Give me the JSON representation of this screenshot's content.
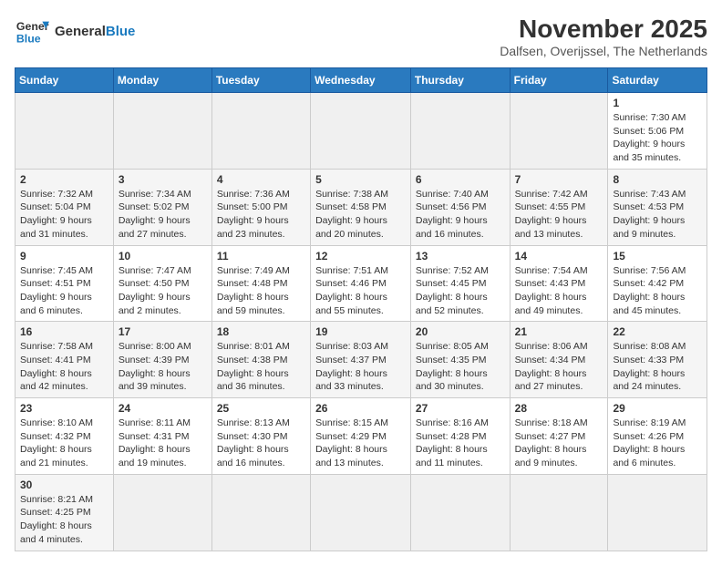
{
  "header": {
    "logo_general": "General",
    "logo_blue": "Blue",
    "month_title": "November 2025",
    "subtitle": "Dalfsen, Overijssel, The Netherlands"
  },
  "days_of_week": [
    "Sunday",
    "Monday",
    "Tuesday",
    "Wednesday",
    "Thursday",
    "Friday",
    "Saturday"
  ],
  "weeks": [
    [
      {
        "day": "",
        "info": ""
      },
      {
        "day": "",
        "info": ""
      },
      {
        "day": "",
        "info": ""
      },
      {
        "day": "",
        "info": ""
      },
      {
        "day": "",
        "info": ""
      },
      {
        "day": "",
        "info": ""
      },
      {
        "day": "1",
        "info": "Sunrise: 7:30 AM\nSunset: 5:06 PM\nDaylight: 9 hours and 35 minutes."
      }
    ],
    [
      {
        "day": "2",
        "info": "Sunrise: 7:32 AM\nSunset: 5:04 PM\nDaylight: 9 hours and 31 minutes."
      },
      {
        "day": "3",
        "info": "Sunrise: 7:34 AM\nSunset: 5:02 PM\nDaylight: 9 hours and 27 minutes."
      },
      {
        "day": "4",
        "info": "Sunrise: 7:36 AM\nSunset: 5:00 PM\nDaylight: 9 hours and 23 minutes."
      },
      {
        "day": "5",
        "info": "Sunrise: 7:38 AM\nSunset: 4:58 PM\nDaylight: 9 hours and 20 minutes."
      },
      {
        "day": "6",
        "info": "Sunrise: 7:40 AM\nSunset: 4:56 PM\nDaylight: 9 hours and 16 minutes."
      },
      {
        "day": "7",
        "info": "Sunrise: 7:42 AM\nSunset: 4:55 PM\nDaylight: 9 hours and 13 minutes."
      },
      {
        "day": "8",
        "info": "Sunrise: 7:43 AM\nSunset: 4:53 PM\nDaylight: 9 hours and 9 minutes."
      }
    ],
    [
      {
        "day": "9",
        "info": "Sunrise: 7:45 AM\nSunset: 4:51 PM\nDaylight: 9 hours and 6 minutes."
      },
      {
        "day": "10",
        "info": "Sunrise: 7:47 AM\nSunset: 4:50 PM\nDaylight: 9 hours and 2 minutes."
      },
      {
        "day": "11",
        "info": "Sunrise: 7:49 AM\nSunset: 4:48 PM\nDaylight: 8 hours and 59 minutes."
      },
      {
        "day": "12",
        "info": "Sunrise: 7:51 AM\nSunset: 4:46 PM\nDaylight: 8 hours and 55 minutes."
      },
      {
        "day": "13",
        "info": "Sunrise: 7:52 AM\nSunset: 4:45 PM\nDaylight: 8 hours and 52 minutes."
      },
      {
        "day": "14",
        "info": "Sunrise: 7:54 AM\nSunset: 4:43 PM\nDaylight: 8 hours and 49 minutes."
      },
      {
        "day": "15",
        "info": "Sunrise: 7:56 AM\nSunset: 4:42 PM\nDaylight: 8 hours and 45 minutes."
      }
    ],
    [
      {
        "day": "16",
        "info": "Sunrise: 7:58 AM\nSunset: 4:41 PM\nDaylight: 8 hours and 42 minutes."
      },
      {
        "day": "17",
        "info": "Sunrise: 8:00 AM\nSunset: 4:39 PM\nDaylight: 8 hours and 39 minutes."
      },
      {
        "day": "18",
        "info": "Sunrise: 8:01 AM\nSunset: 4:38 PM\nDaylight: 8 hours and 36 minutes."
      },
      {
        "day": "19",
        "info": "Sunrise: 8:03 AM\nSunset: 4:37 PM\nDaylight: 8 hours and 33 minutes."
      },
      {
        "day": "20",
        "info": "Sunrise: 8:05 AM\nSunset: 4:35 PM\nDaylight: 8 hours and 30 minutes."
      },
      {
        "day": "21",
        "info": "Sunrise: 8:06 AM\nSunset: 4:34 PM\nDaylight: 8 hours and 27 minutes."
      },
      {
        "day": "22",
        "info": "Sunrise: 8:08 AM\nSunset: 4:33 PM\nDaylight: 8 hours and 24 minutes."
      }
    ],
    [
      {
        "day": "23",
        "info": "Sunrise: 8:10 AM\nSunset: 4:32 PM\nDaylight: 8 hours and 21 minutes."
      },
      {
        "day": "24",
        "info": "Sunrise: 8:11 AM\nSunset: 4:31 PM\nDaylight: 8 hours and 19 minutes."
      },
      {
        "day": "25",
        "info": "Sunrise: 8:13 AM\nSunset: 4:30 PM\nDaylight: 8 hours and 16 minutes."
      },
      {
        "day": "26",
        "info": "Sunrise: 8:15 AM\nSunset: 4:29 PM\nDaylight: 8 hours and 13 minutes."
      },
      {
        "day": "27",
        "info": "Sunrise: 8:16 AM\nSunset: 4:28 PM\nDaylight: 8 hours and 11 minutes."
      },
      {
        "day": "28",
        "info": "Sunrise: 8:18 AM\nSunset: 4:27 PM\nDaylight: 8 hours and 9 minutes."
      },
      {
        "day": "29",
        "info": "Sunrise: 8:19 AM\nSunset: 4:26 PM\nDaylight: 8 hours and 6 minutes."
      }
    ],
    [
      {
        "day": "30",
        "info": "Sunrise: 8:21 AM\nSunset: 4:25 PM\nDaylight: 8 hours and 4 minutes."
      },
      {
        "day": "",
        "info": ""
      },
      {
        "day": "",
        "info": ""
      },
      {
        "day": "",
        "info": ""
      },
      {
        "day": "",
        "info": ""
      },
      {
        "day": "",
        "info": ""
      },
      {
        "day": "",
        "info": ""
      }
    ]
  ]
}
